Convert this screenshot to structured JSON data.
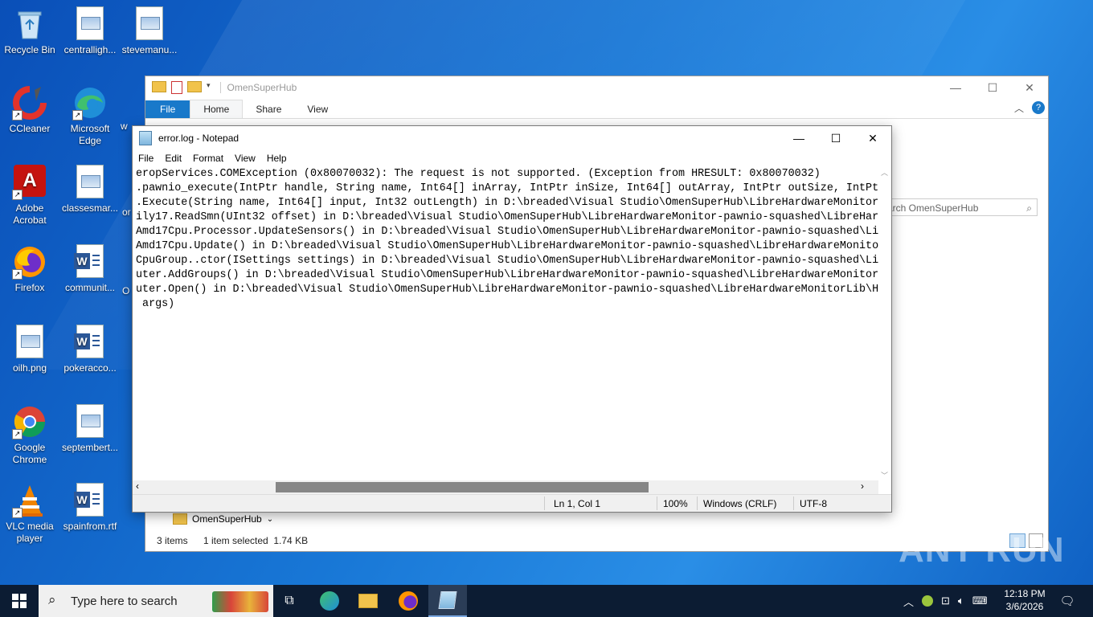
{
  "desktop": {
    "icons": [
      {
        "label": "Recycle Bin"
      },
      {
        "label": "centralligh..."
      },
      {
        "label": "stevemanu..."
      },
      {
        "label": "CCleaner"
      },
      {
        "label": "Microsoft Edge"
      },
      {
        "label": "w"
      },
      {
        "label": "Adobe Acrobat"
      },
      {
        "label": "classesmar..."
      },
      {
        "label": "or"
      },
      {
        "label": "Firefox"
      },
      {
        "label": "communit..."
      },
      {
        "label": "O"
      },
      {
        "label": "oilh.png"
      },
      {
        "label": "pokeracco..."
      },
      {
        "label": "Google Chrome"
      },
      {
        "label": "septembert..."
      },
      {
        "label": "VLC media player"
      },
      {
        "label": "spainfrom.rtf"
      }
    ]
  },
  "explorer": {
    "title": "OmenSuperHub",
    "tabs": [
      "File",
      "Home",
      "Share",
      "View"
    ],
    "search_placeholder": "Search OmenSuperHub",
    "search_visible": "arch OmenSuperHub",
    "nav_folder": "OmenSuperHub",
    "status_items": "3 items",
    "status_selected": "1 item selected  1.74 KB"
  },
  "notepad": {
    "title": "error.log - Notepad",
    "menu": [
      "File",
      "Edit",
      "Format",
      "View",
      "Help"
    ],
    "lines": [
      "eropServices.COMException (0x80070032): The request is not supported. (Exception from HRESULT: 0x80070032)",
      ".pawnio_execute(IntPtr handle, String name, Int64[] inArray, IntPtr inSize, Int64[] outArray, IntPtr outSize, IntPt",
      ".Execute(String name, Int64[] input, Int32 outLength) in D:\\breaded\\Visual Studio\\OmenSuperHub\\LibreHardwareMonitor",
      "ily17.ReadSmn(UInt32 offset) in D:\\breaded\\Visual Studio\\OmenSuperHub\\LibreHardwareMonitor-pawnio-squashed\\LibreHar",
      "Amd17Cpu.Processor.UpdateSensors() in D:\\breaded\\Visual Studio\\OmenSuperHub\\LibreHardwareMonitor-pawnio-squashed\\Li",
      "Amd17Cpu.Update() in D:\\breaded\\Visual Studio\\OmenSuperHub\\LibreHardwareMonitor-pawnio-squashed\\LibreHardwareMonito",
      "CpuGroup..ctor(ISettings settings) in D:\\breaded\\Visual Studio\\OmenSuperHub\\LibreHardwareMonitor-pawnio-squashed\\Li",
      "uter.AddGroups() in D:\\breaded\\Visual Studio\\OmenSuperHub\\LibreHardwareMonitor-pawnio-squashed\\LibreHardwareMonitor",
      "uter.Open() in D:\\breaded\\Visual Studio\\OmenSuperHub\\LibreHardwareMonitor-pawnio-squashed\\LibreHardwareMonitorLib\\H",
      " args)"
    ],
    "status": {
      "position": "Ln 1, Col 1",
      "zoom": "100%",
      "line_ending": "Windows (CRLF)",
      "encoding": "UTF-8"
    }
  },
  "taskbar": {
    "search_placeholder": "Type here to search",
    "time": "12:18 PM",
    "date": "3/6/2026"
  },
  "watermark": "ANY RUN"
}
